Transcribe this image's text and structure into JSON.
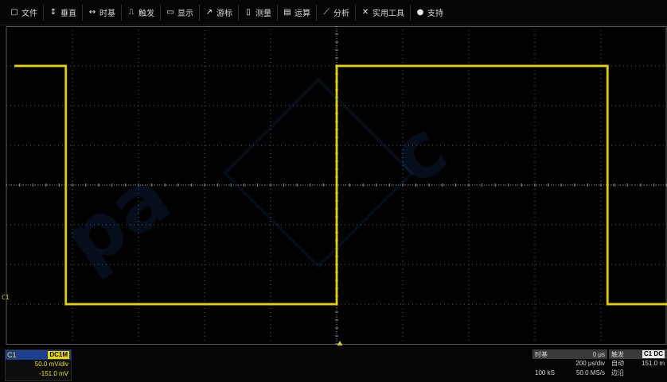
{
  "menu": [
    {
      "label": "文件",
      "icon": "file-icon",
      "glyph": "▢"
    },
    {
      "label": "垂直",
      "icon": "vertical-icon",
      "glyph": "↕"
    },
    {
      "label": "时基",
      "icon": "horizontal-icon",
      "glyph": "↔"
    },
    {
      "label": "触发",
      "icon": "trigger-icon",
      "glyph": "⎍"
    },
    {
      "label": "显示",
      "icon": "display-icon",
      "glyph": "▭"
    },
    {
      "label": "游标",
      "icon": "cursor-icon",
      "glyph": "↗"
    },
    {
      "label": "测量",
      "icon": "measure-icon",
      "glyph": "▯"
    },
    {
      "label": "运算",
      "icon": "math-icon",
      "glyph": "▤"
    },
    {
      "label": "分析",
      "icon": "analysis-icon",
      "glyph": "⟋"
    },
    {
      "label": "实用工具",
      "icon": "utility-icon",
      "glyph": "✕"
    },
    {
      "label": "支持",
      "icon": "help-icon",
      "glyph": "●"
    }
  ],
  "screen": {
    "channel_marker": "C1",
    "trace_color": "#e6d200",
    "grid_color": "#5a5a5a",
    "waveform": {
      "type": "square",
      "high_level_divs": 3.0,
      "low_level_divs": -3.0,
      "edges_divs": [
        -4.1,
        0.0,
        4.1
      ],
      "start_state": "high"
    }
  },
  "channel": {
    "name": "C1",
    "coupling": "DC1M",
    "scale": "50.0 mV/div",
    "offset": "-151.0 mV"
  },
  "timebase": {
    "label": "时基",
    "delay": "0 μs",
    "scale": "200 μs/div",
    "memory": "100 kS",
    "sample_rate": "50.0 MS/s"
  },
  "trigger": {
    "label": "触发",
    "source": "C1 DC",
    "mode": "自动",
    "level": "151.0 m",
    "type": "边沿"
  }
}
